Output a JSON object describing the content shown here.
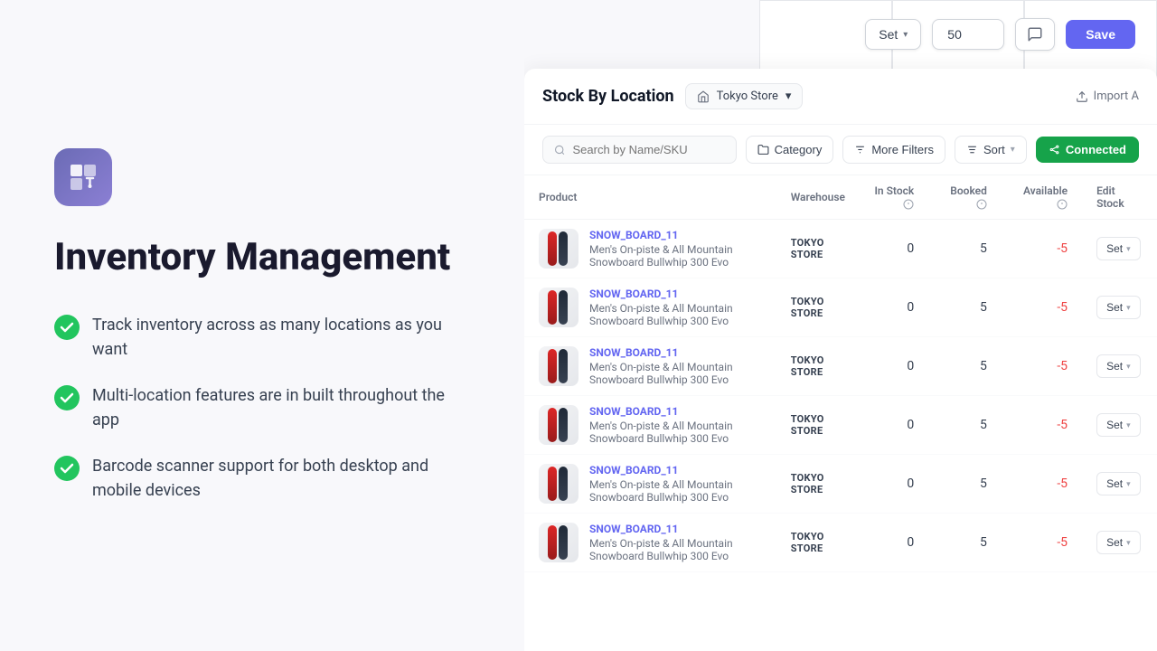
{
  "left": {
    "title": "Inventory Management",
    "features": [
      "Track inventory across as many locations as you want",
      "Multi-location features are in built throughout the app",
      "Barcode scanner support for both desktop and mobile devices"
    ]
  },
  "toolbar": {
    "set_label": "Set",
    "quantity_value": "50",
    "save_label": "Save"
  },
  "header": {
    "title": "Stock By Location",
    "location": "Tokyo Store",
    "import_label": "Import A"
  },
  "filters": {
    "search_placeholder": "Search by Name/SKU",
    "category_label": "Category",
    "more_filters_label": "More Filters",
    "sort_label": "Sort",
    "connected_label": "Connected"
  },
  "table": {
    "columns": [
      "Product",
      "Warehouse",
      "In Stock",
      "Booked",
      "Available",
      "Edit Stock"
    ],
    "rows": [
      {
        "sku": "SNOW_BOARD_11",
        "name": "Men's On-piste & All Mountain Snowboard Bullwhip 300 Evo",
        "warehouse": "TOKYO\nSTORE",
        "in_stock": "0",
        "booked": "5",
        "available": "-5",
        "action": "Set"
      },
      {
        "sku": "SNOW_BOARD_11",
        "name": "Men's On-piste & All Mountain Snowboard Bullwhip 300 Evo",
        "warehouse": "TOKYO\nSTORE",
        "in_stock": "0",
        "booked": "5",
        "available": "-5",
        "action": "Set"
      },
      {
        "sku": "SNOW_BOARD_11",
        "name": "Men's On-piste & All Mountain Snowboard Bullwhip 300 Evo",
        "warehouse": "TOKYO\nSTORE",
        "in_stock": "0",
        "booked": "5",
        "available": "-5",
        "action": "Set"
      },
      {
        "sku": "SNOW_BOARD_11",
        "name": "Men's On-piste & All Mountain Snowboard Bullwhip 300 Evo",
        "warehouse": "TOKYO\nSTORE",
        "in_stock": "0",
        "booked": "5",
        "available": "-5",
        "action": "Set"
      },
      {
        "sku": "SNOW_BOARD_11",
        "name": "Men's On-piste & All Mountain Snowboard Bullwhip 300 Evo",
        "warehouse": "TOKYO\nSTORE",
        "in_stock": "0",
        "booked": "5",
        "available": "-5",
        "action": "Set"
      },
      {
        "sku": "SNOW_BOARD_11",
        "name": "Men's On-piste & All Mountain Snowboard Bullwhip 300 Evo",
        "warehouse": "TOKYO\nSTORE",
        "in_stock": "0",
        "booked": "5",
        "available": "-5",
        "action": "Set"
      }
    ]
  },
  "icons": {
    "search": "🔍",
    "store": "🏪",
    "chevron_down": "▾",
    "sort": "↕",
    "filter": "⊟",
    "category": "☰",
    "import": "↑",
    "connected": "⚡",
    "comment": "💬"
  }
}
